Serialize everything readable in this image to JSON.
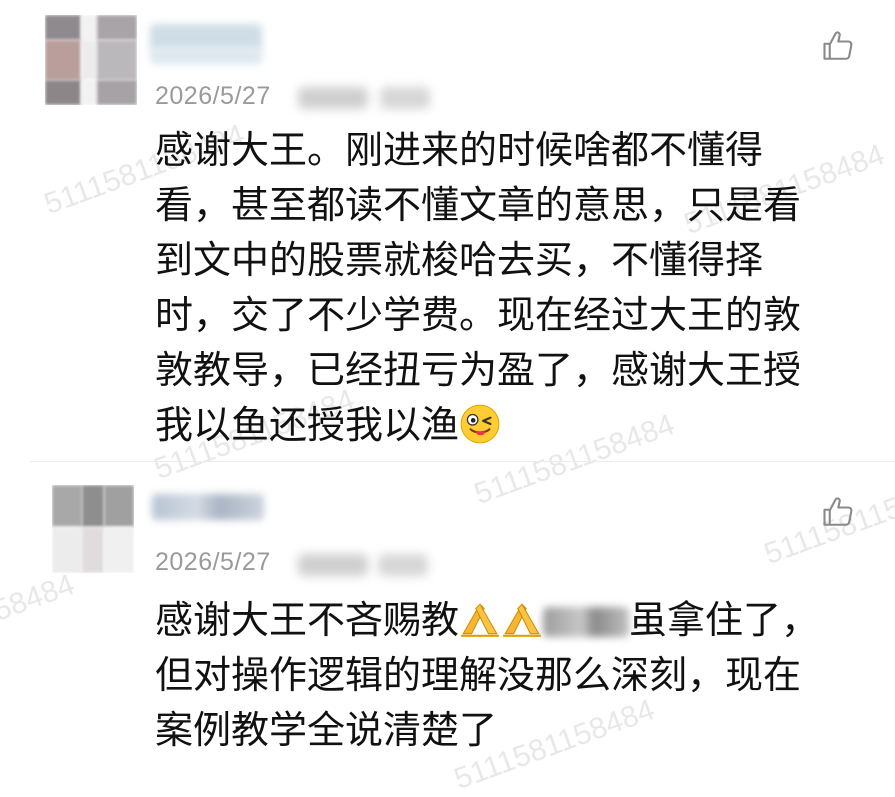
{
  "comments": [
    {
      "date": "2026/5/27",
      "text_lines": [
        "感谢大王。刚进来的时候啥都不懂得",
        "看，甚至都读不懂文章的意思，只是看",
        "到文中的股票就梭哈去买，不懂得择",
        "时，交了不少学费。现在经过大王的敦",
        "敦教导，已经扭亏为盈了，感谢大王授",
        "我以鱼还授我以渔"
      ],
      "emoji": "winking-tongue-emoji"
    },
    {
      "date": "2026/5/27",
      "text_parts": {
        "line1_a": "感谢大王不吝赐教",
        "line1_b": "虽拿住了，"
      },
      "text_lines": [
        "但对操作逻辑的理解没那么深刻，现在",
        "案例教学全说清楚了"
      ],
      "emoji": "folded-hands-emoji"
    }
  ],
  "watermark": "5111581158484",
  "colors": {
    "text": "#111111",
    "date": "#9a9a9a",
    "like_icon": "#8a8a8a"
  }
}
